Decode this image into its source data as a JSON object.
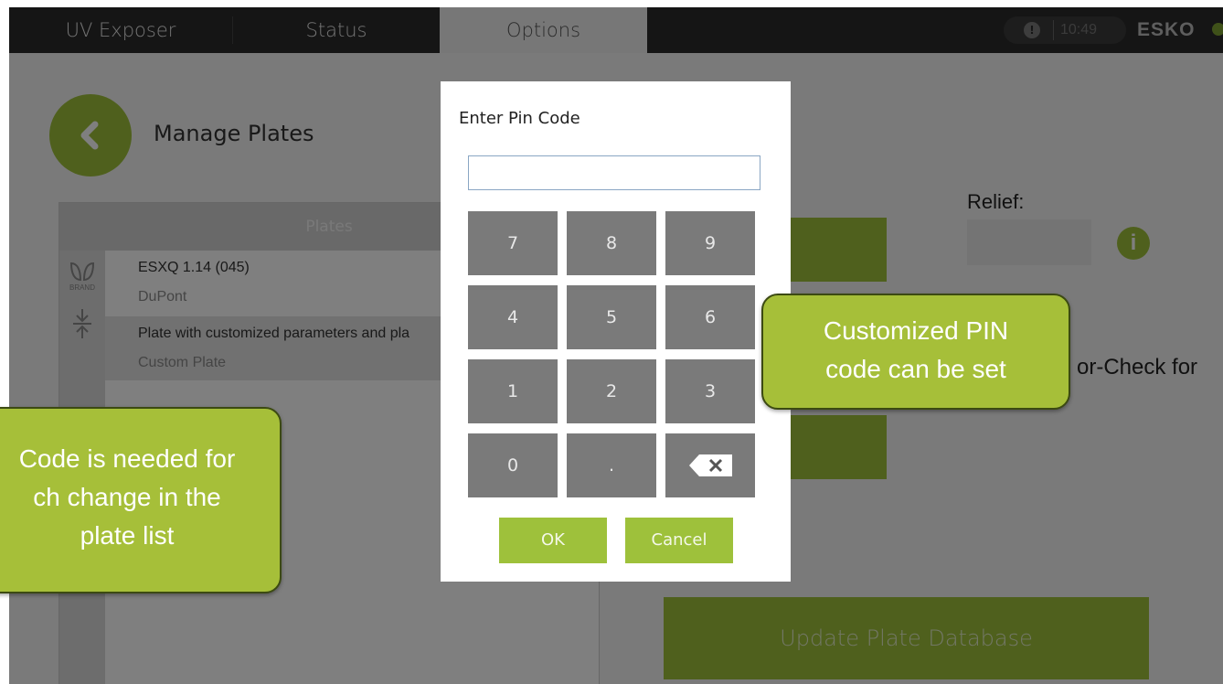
{
  "tabs": [
    {
      "label": "UV Exposer"
    },
    {
      "label": "Status"
    },
    {
      "label": "Options"
    }
  ],
  "header": {
    "clock": "10:49",
    "logo": "ESKO"
  },
  "page": {
    "title": "Manage Plates"
  },
  "plates": {
    "header": "Plates",
    "brand_label": "BRAND",
    "rows": [
      {
        "name": "ESXQ 1.14 (045)",
        "sub": "DuPont"
      },
      {
        "name": "Plate with customized parameters and pla",
        "sub": "Custom Plate"
      }
    ]
  },
  "right": {
    "relief_label": "Relief:",
    "precheck_text": "or-Check for",
    "update_label": "Update Plate Database"
  },
  "dialog": {
    "title": "Enter Pin Code",
    "input_value": "",
    "keys": [
      "7",
      "8",
      "9",
      "4",
      "5",
      "6",
      "1",
      "2",
      "3",
      "0",
      "."
    ],
    "ok_label": "OK",
    "cancel_label": "Cancel"
  },
  "callouts": {
    "left_lines": [
      "Code is needed for",
      "ch change in the",
      "plate list"
    ],
    "right_lines": [
      "Customized PIN",
      "code can be set"
    ]
  },
  "colors": {
    "accent": "#9ec13b",
    "callout": "#a6bf39",
    "topbar": "#2b2b2b"
  }
}
